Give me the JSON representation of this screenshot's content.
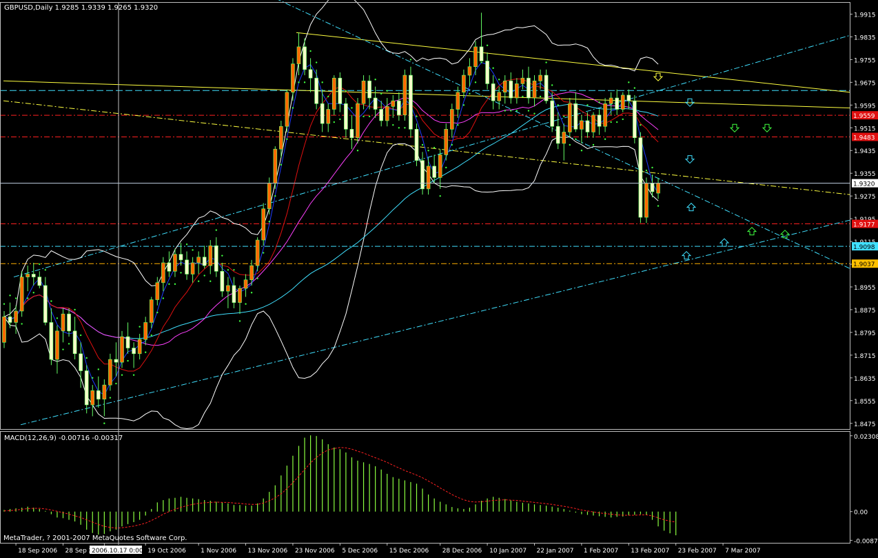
{
  "window": {
    "symbol_header": "GBPUSD,Daily  1.9285 1.9339 1.9265 1.9320",
    "copyright": "MetaTrader, ? 2001-2007 MetaQuotes Software Corp.",
    "cursor_date": "2006.10.17 0:00"
  },
  "colors": {
    "background": "#000000",
    "grid": "#c0c0c0",
    "candle_up": "#ff6a00",
    "candle_down": "#f5ffc8",
    "candle_outline": "#66ff66",
    "bb": "#ffffff",
    "ma_fast": "#1e3cff",
    "ma_red": "#e01010",
    "ma_magenta": "#ff40ff",
    "ma_cyan": "#40e0ff",
    "psar": "#40ff40",
    "macd_hist": "#8cff40",
    "macd_signal": "#ff2020",
    "trend_yellow": "#ffff40",
    "trend_cyan": "#40e0ff",
    "level_red": "#ff2020",
    "level_cyan": "#40e0ff",
    "level_orange": "#ffb000"
  },
  "chart_data": [
    {
      "type": "candlestick",
      "title": "GBPUSD,Daily",
      "ohlc_readout": [
        1.9285,
        1.9339,
        1.9265,
        1.932
      ],
      "ylim": [
        1.8455,
        1.9955
      ],
      "y_ticks": [
        "1.9915",
        "1.9835",
        "1.9755",
        "1.9675",
        "1.9595",
        "1.9515",
        "1.9435",
        "1.9355",
        "1.9275",
        "1.9195",
        "1.9115",
        "1.9035",
        "1.8955",
        "1.8875",
        "1.8795",
        "1.8715",
        "1.8635",
        "1.8555",
        "1.8475"
      ],
      "x_tick_labels": [
        "18 Sep 2006",
        "28 Sep 2006",
        "9 Oct 2006",
        "19 Oct 2006",
        "1 Nov 2006",
        "13 Nov 2006",
        "23 Nov 2006",
        "5 Dec 2006",
        "15 Dec 2006",
        "28 Dec 2006",
        "10 Jan 2007",
        "22 Jan 2007",
        "1 Feb 2007",
        "13 Feb 2007",
        "23 Feb 2007",
        "7 Mar 2007"
      ],
      "x_tick_bar_index": [
        2,
        10,
        17,
        24,
        33,
        41,
        49,
        57,
        65,
        74,
        82,
        90,
        98,
        106,
        114,
        122
      ],
      "candles": [
        [
          1.876,
          1.887,
          1.874,
          1.885
        ],
        [
          1.885,
          1.89,
          1.881,
          1.883
        ],
        [
          1.883,
          1.889,
          1.879,
          1.887
        ],
        [
          1.887,
          1.901,
          1.885,
          1.899
        ],
        [
          1.899,
          1.903,
          1.894,
          1.9
        ],
        [
          1.9,
          1.904,
          1.896,
          1.899
        ],
        [
          1.899,
          1.901,
          1.895,
          1.896
        ],
        [
          1.896,
          1.899,
          1.882,
          1.883
        ],
        [
          1.883,
          1.888,
          1.868,
          1.87
        ],
        [
          1.87,
          1.882,
          1.865,
          1.88
        ],
        [
          1.88,
          1.888,
          1.876,
          1.886
        ],
        [
          1.886,
          1.888,
          1.878,
          1.88
        ],
        [
          1.88,
          1.885,
          1.87,
          1.872
        ],
        [
          1.872,
          1.876,
          1.86,
          1.866
        ],
        [
          1.866,
          1.868,
          1.851,
          1.854
        ],
        [
          1.854,
          1.861,
          1.85,
          1.859
        ],
        [
          1.859,
          1.864,
          1.853,
          1.856
        ],
        [
          1.856,
          1.863,
          1.85,
          1.861
        ],
        [
          1.861,
          1.872,
          1.859,
          1.87
        ],
        [
          1.87,
          1.876,
          1.864,
          1.869
        ],
        [
          1.869,
          1.88,
          1.867,
          1.878
        ],
        [
          1.878,
          1.883,
          1.872,
          1.874
        ],
        [
          1.874,
          1.876,
          1.867,
          1.872
        ],
        [
          1.872,
          1.879,
          1.87,
          1.877
        ],
        [
          1.877,
          1.885,
          1.875,
          1.883
        ],
        [
          1.883,
          1.892,
          1.881,
          1.891
        ],
        [
          1.891,
          1.899,
          1.889,
          1.897
        ],
        [
          1.897,
          1.906,
          1.894,
          1.904
        ],
        [
          1.904,
          1.908,
          1.899,
          1.901
        ],
        [
          1.901,
          1.909,
          1.899,
          1.907
        ],
        [
          1.907,
          1.911,
          1.903,
          1.905
        ],
        [
          1.905,
          1.908,
          1.898,
          1.9
        ],
        [
          1.9,
          1.906,
          1.897,
          1.904
        ],
        [
          1.904,
          1.908,
          1.9,
          1.906
        ],
        [
          1.906,
          1.91,
          1.902,
          1.903
        ],
        [
          1.903,
          1.912,
          1.9,
          1.91
        ],
        [
          1.91,
          1.913,
          1.899,
          1.901
        ],
        [
          1.901,
          1.904,
          1.892,
          1.894
        ],
        [
          1.894,
          1.899,
          1.888,
          1.896
        ],
        [
          1.896,
          1.899,
          1.888,
          1.89
        ],
        [
          1.89,
          1.896,
          1.886,
          1.895
        ],
        [
          1.895,
          1.9,
          1.892,
          1.898
        ],
        [
          1.898,
          1.905,
          1.896,
          1.903
        ],
        [
          1.903,
          1.913,
          1.901,
          1.912
        ],
        [
          1.912,
          1.925,
          1.91,
          1.923
        ],
        [
          1.923,
          1.934,
          1.921,
          1.932
        ],
        [
          1.932,
          1.945,
          1.93,
          1.944
        ],
        [
          1.944,
          1.954,
          1.941,
          1.952
        ],
        [
          1.952,
          1.965,
          1.95,
          1.964
        ],
        [
          1.964,
          1.976,
          1.961,
          1.974
        ],
        [
          1.974,
          1.985,
          1.97,
          1.98
        ],
        [
          1.98,
          1.983,
          1.97,
          1.972
        ],
        [
          1.972,
          1.976,
          1.964,
          1.969
        ],
        [
          1.969,
          1.972,
          1.958,
          1.96
        ],
        [
          1.96,
          1.965,
          1.95,
          1.953
        ],
        [
          1.953,
          1.96,
          1.95,
          1.958
        ],
        [
          1.958,
          1.97,
          1.956,
          1.969
        ],
        [
          1.969,
          1.971,
          1.957,
          1.96
        ],
        [
          1.96,
          1.962,
          1.948,
          1.951
        ],
        [
          1.951,
          1.956,
          1.944,
          1.948
        ],
        [
          1.948,
          1.962,
          1.946,
          1.96
        ],
        [
          1.96,
          1.97,
          1.958,
          1.968
        ],
        [
          1.968,
          1.97,
          1.958,
          1.962
        ],
        [
          1.962,
          1.966,
          1.955,
          1.958
        ],
        [
          1.958,
          1.961,
          1.952,
          1.954
        ],
        [
          1.954,
          1.962,
          1.952,
          1.959
        ],
        [
          1.959,
          1.963,
          1.955,
          1.961
        ],
        [
          1.961,
          1.964,
          1.954,
          1.956
        ],
        [
          1.956,
          1.972,
          1.954,
          1.97
        ],
        [
          1.97,
          1.973,
          1.948,
          1.951
        ],
        [
          1.951,
          1.953,
          1.938,
          1.94
        ],
        [
          1.94,
          1.943,
          1.928,
          1.93
        ],
        [
          1.93,
          1.941,
          1.928,
          1.938
        ],
        [
          1.938,
          1.942,
          1.932,
          1.934
        ],
        [
          1.934,
          1.944,
          1.93,
          1.942
        ],
        [
          1.942,
          1.953,
          1.94,
          1.951
        ],
        [
          1.951,
          1.96,
          1.948,
          1.958
        ],
        [
          1.958,
          1.966,
          1.955,
          1.964
        ],
        [
          1.964,
          1.972,
          1.962,
          1.97
        ],
        [
          1.97,
          1.976,
          1.966,
          1.973
        ],
        [
          1.973,
          1.982,
          1.97,
          1.98
        ],
        [
          1.98,
          1.992,
          1.977,
          1.975
        ],
        [
          1.975,
          1.978,
          1.965,
          1.967
        ],
        [
          1.967,
          1.97,
          1.958,
          1.961
        ],
        [
          1.961,
          1.966,
          1.958,
          1.964
        ],
        [
          1.964,
          1.97,
          1.96,
          1.968
        ],
        [
          1.968,
          1.971,
          1.96,
          1.962
        ],
        [
          1.962,
          1.969,
          1.96,
          1.967
        ],
        [
          1.967,
          1.972,
          1.965,
          1.969
        ],
        [
          1.969,
          1.973,
          1.96,
          1.962
        ],
        [
          1.962,
          1.97,
          1.959,
          1.968
        ],
        [
          1.968,
          1.972,
          1.965,
          1.97
        ],
        [
          1.97,
          1.972,
          1.96,
          1.961
        ],
        [
          1.961,
          1.964,
          1.95,
          1.952
        ],
        [
          1.952,
          1.957,
          1.944,
          1.946
        ],
        [
          1.946,
          1.953,
          1.94,
          1.95
        ],
        [
          1.95,
          1.962,
          1.948,
          1.96
        ],
        [
          1.96,
          1.964,
          1.95,
          1.951
        ],
        [
          1.951,
          1.956,
          1.946,
          1.954
        ],
        [
          1.954,
          1.957,
          1.948,
          1.95
        ],
        [
          1.95,
          1.957,
          1.948,
          1.956
        ],
        [
          1.956,
          1.958,
          1.949,
          1.952
        ],
        [
          1.952,
          1.962,
          1.95,
          1.96
        ],
        [
          1.96,
          1.964,
          1.956,
          1.962
        ],
        [
          1.962,
          1.965,
          1.956,
          1.958
        ],
        [
          1.958,
          1.964,
          1.957,
          1.963
        ],
        [
          1.963,
          1.965,
          1.958,
          1.961
        ],
        [
          1.961,
          1.963,
          1.946,
          1.948
        ],
        [
          1.948,
          1.95,
          1.918,
          1.92
        ],
        [
          1.92,
          1.934,
          1.918,
          1.932
        ],
        [
          1.932,
          1.935,
          1.927,
          1.929
        ],
        [
          1.9285,
          1.9339,
          1.9265,
          1.932
        ]
      ],
      "levels": [
        {
          "label": "1.9559",
          "value": 1.9559,
          "color": "red"
        },
        {
          "label": "1.9483",
          "value": 1.9483,
          "color": "red"
        },
        {
          "label": "1.9320",
          "value": 1.932,
          "color": "white"
        },
        {
          "label": "1.9177",
          "value": 1.9177,
          "color": "red"
        },
        {
          "label": "1.9098",
          "value": 1.9098,
          "color": "cyan"
        },
        {
          "label": "1.9037",
          "value": 1.9037,
          "color": "orange"
        }
      ],
      "horizontal_line_cyan": 1.9646
    },
    {
      "type": "bar",
      "title": "MACD(12,26,9) -0.00716 -0.00317",
      "ylim": [
        -0.0095,
        0.0245
      ],
      "y_ticks": [
        "0.02308",
        "0.00",
        "-0.00874"
      ],
      "histogram": [
        0.0005,
        0.0008,
        0.001,
        0.0012,
        0.0015,
        0.0012,
        0.0008,
        0.0002,
        -0.0008,
        -0.0018,
        -0.002,
        -0.0025,
        -0.003,
        -0.004,
        -0.0055,
        -0.0065,
        -0.007,
        -0.0068,
        -0.006,
        -0.0055,
        -0.0045,
        -0.0038,
        -0.0032,
        -0.0025,
        -0.0012,
        0.0008,
        0.0028,
        0.0035,
        0.004,
        0.0042,
        0.0045,
        0.0042,
        0.004,
        0.0038,
        0.0035,
        0.0033,
        0.003,
        0.0028,
        0.0025,
        0.002,
        0.002,
        0.0018,
        0.0018,
        0.0025,
        0.004,
        0.006,
        0.008,
        0.011,
        0.014,
        0.017,
        0.02,
        0.0225,
        0.0232,
        0.023,
        0.022,
        0.0205,
        0.0195,
        0.019,
        0.018,
        0.0165,
        0.0155,
        0.015,
        0.0145,
        0.0138,
        0.0128,
        0.0115,
        0.0105,
        0.01,
        0.0095,
        0.009,
        0.0085,
        0.007,
        0.0052,
        0.004,
        0.003,
        0.0022,
        0.0014,
        0.001,
        0.0008,
        0.0012,
        0.0022,
        0.0033,
        0.004,
        0.0045,
        0.0042,
        0.0038,
        0.0034,
        0.003,
        0.0027,
        0.0025,
        0.0022,
        0.002,
        0.0018,
        0.0015,
        0.0012,
        0.0008,
        0.0003,
        -0.0003,
        -0.0008,
        -0.001,
        -0.0012,
        -0.0014,
        -0.0016,
        -0.0018,
        -0.0016,
        -0.0015,
        -0.0012,
        -0.001,
        -0.0008,
        -0.001,
        -0.0025,
        -0.0045,
        -0.0058,
        -0.0066,
        -0.0072
      ],
      "signal": [
        0.0002,
        0.0003,
        0.0005,
        0.0007,
        0.0009,
        0.001,
        0.001,
        0.0008,
        0.0005,
        0.0001,
        -0.0003,
        -0.0008,
        -0.0013,
        -0.0018,
        -0.0025,
        -0.0032,
        -0.0039,
        -0.0045,
        -0.0048,
        -0.005,
        -0.0049,
        -0.0047,
        -0.0044,
        -0.004,
        -0.0035,
        -0.0027,
        -0.0018,
        -0.0008,
        0.0,
        0.0007,
        0.0013,
        0.0018,
        0.0022,
        0.0025,
        0.0027,
        0.0028,
        0.0029,
        0.0028,
        0.0028,
        0.0026,
        0.0025,
        0.0023,
        0.0022,
        0.0022,
        0.0026,
        0.0033,
        0.0042,
        0.0054,
        0.007,
        0.0088,
        0.0108,
        0.0128,
        0.0148,
        0.0165,
        0.0178,
        0.0188,
        0.0192,
        0.0195,
        0.0194,
        0.019,
        0.0184,
        0.0178,
        0.0171,
        0.0164,
        0.0157,
        0.015,
        0.0141,
        0.0133,
        0.0125,
        0.0118,
        0.0111,
        0.0103,
        0.0093,
        0.0083,
        0.0072,
        0.0062,
        0.0052,
        0.0043,
        0.0036,
        0.0031,
        0.0029,
        0.003,
        0.0032,
        0.0034,
        0.0035,
        0.0036,
        0.0035,
        0.0034,
        0.0032,
        0.003,
        0.0028,
        0.0026,
        0.0024,
        0.0022,
        0.0019,
        0.0016,
        0.0013,
        0.0009,
        0.0005,
        0.0002,
        -0.0001,
        -0.0004,
        -0.0006,
        -0.0008,
        -0.001,
        -0.0011,
        -0.0011,
        -0.0011,
        -0.001,
        -0.001,
        -0.0013,
        -0.0019,
        -0.0025,
        -0.0029,
        -0.0032
      ]
    }
  ]
}
